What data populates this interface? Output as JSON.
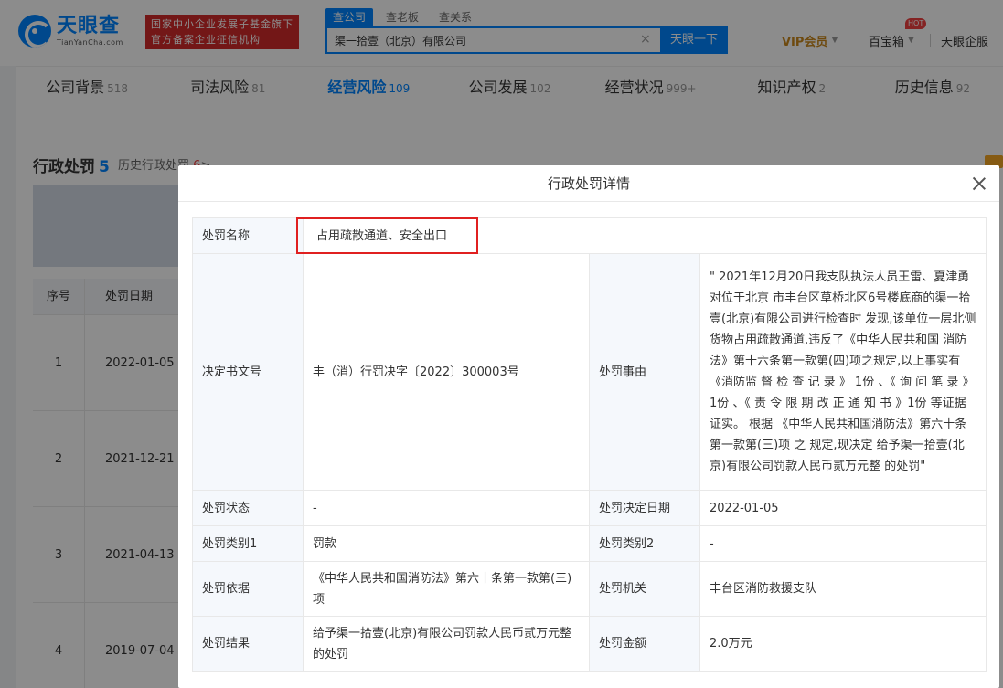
{
  "header": {
    "logo_cn": "天眼查",
    "logo_en": "TianYanCha.com",
    "badge_line1": "国家中小企业发展子基金旗下",
    "badge_line2": "官方备案企业征信机构",
    "search_tabs": [
      "查公司",
      "查老板",
      "查关系"
    ],
    "search_value": "渠一拾壹（北京）有限公司",
    "search_button": "天眼一下",
    "vip": "VIP会员",
    "toolbox": "百宝箱",
    "hot": "HOT",
    "enterprise": "天眼企服"
  },
  "tabs": [
    {
      "label": "公司背景",
      "count": "518"
    },
    {
      "label": "司法风险",
      "count": "81"
    },
    {
      "label": "经营风险",
      "count": "109"
    },
    {
      "label": "公司发展",
      "count": "102"
    },
    {
      "label": "经营状况",
      "count": "999+"
    },
    {
      "label": "知识产权",
      "count": "2"
    },
    {
      "label": "历史信息",
      "count": "92"
    }
  ],
  "section": {
    "title": "行政处罚",
    "count": "5",
    "history_label": "历史行政处罚",
    "history_count": "6",
    "history_arrow": ">"
  },
  "bg_table": {
    "headers": [
      "序号",
      "处罚日期"
    ],
    "rows": [
      {
        "idx": "1",
        "date": "2022-01-05"
      },
      {
        "idx": "2",
        "date": "2021-12-21"
      },
      {
        "idx": "3",
        "date": "2021-04-13"
      },
      {
        "idx": "4",
        "date": "2019-07-04"
      }
    ]
  },
  "modal": {
    "title": "行政处罚详情",
    "rows": [
      {
        "label": "处罚名称",
        "value": "占用疏散通道、安全出口"
      },
      {
        "label": "决定书文号",
        "value": "丰（消）行罚决字〔2022〕300003号",
        "label2": "处罚事由",
        "value2": "\" 2021年12月20日我支队执法人员王雷、夏津勇对位于北京 市丰台区草桥北区6号楼底商的渠一拾壹(北京)有限公司进行检查时 发现,该单位一层北侧货物占用疏散通道,违反了《中华人民共和国 消防法》第十六条第一款第(四)项之规定,以上事实有 《消防监 督 检 查 记 录 》 1份 、《 询 问 笔 录 》 1份 、《 责 令 限 期 改 正 通 知 书 》1份 等证据证实。 根据 《中华人民共和国消防法》第六十条第一款第(三)项 之 规定,现决定 给予渠一拾壹(北京)有限公司罚款人民币贰万元整 的处罚\""
      },
      {
        "label": "处罚状态",
        "value": "-",
        "label2": "处罚决定日期",
        "value2": "2022-01-05"
      },
      {
        "label": "处罚类别1",
        "value": "罚款",
        "label2": "处罚类别2",
        "value2": "-"
      },
      {
        "label": "处罚依据",
        "value": "《中华人民共和国消防法》第六十条第一款第(三)项",
        "label2": "处罚机关",
        "value2": "丰台区消防救援支队"
      },
      {
        "label": "处罚结果",
        "value": "给予渠一拾壹(北京)有限公司罚款人民币贰万元整 的处罚",
        "label2": "处罚金额",
        "value2": "2.0万元"
      }
    ]
  },
  "colors": {
    "brand": "#0084ff",
    "highlight": "#e02020",
    "overlay": "rgba(0,0,0,0.45)"
  }
}
